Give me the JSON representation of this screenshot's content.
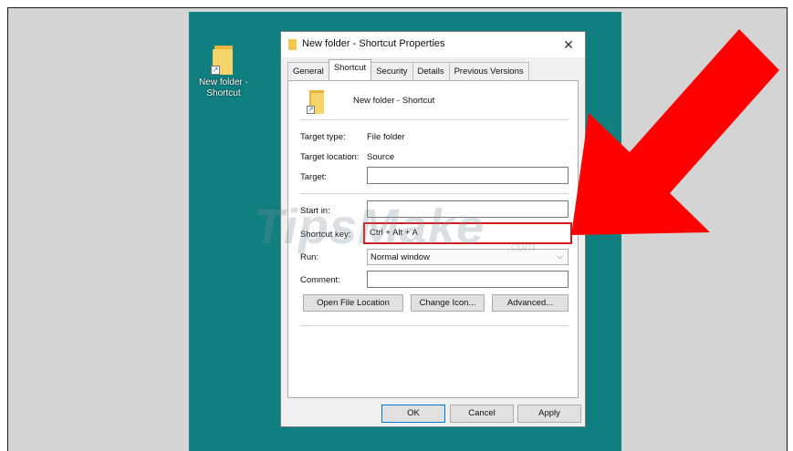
{
  "desktop_icon": {
    "label": "New folder - Shortcut"
  },
  "dialog": {
    "title": "New folder - Shortcut Properties",
    "close_glyph": "✕",
    "tabs": [
      "General",
      "Shortcut",
      "Security",
      "Details",
      "Previous Versions"
    ],
    "active_tab": "Shortcut",
    "shortcut_name": "New folder - Shortcut",
    "fields": {
      "target_type_label": "Target type:",
      "target_type_value": "File folder",
      "target_location_label": "Target location:",
      "target_location_value": "Source",
      "target_label": "Target:",
      "target_value": "",
      "start_in_label": "Start in:",
      "start_in_value": "",
      "shortcut_key_label": "Shortcut key:",
      "shortcut_key_value": "Ctrl + Alt + A",
      "run_label": "Run:",
      "run_value": "Normal window",
      "comment_label": "Comment:",
      "comment_value": ""
    },
    "buttons": {
      "open_file_location": "Open File Location",
      "change_icon": "Change Icon...",
      "advanced": "Advanced...",
      "ok": "OK",
      "cancel": "Cancel",
      "apply": "Apply"
    }
  },
  "watermark": {
    "text": "TipsMake",
    "suffix": ".com"
  },
  "colors": {
    "desktop": "#107f80",
    "arrow": "#ff0000",
    "highlight": "#d51b1b"
  }
}
